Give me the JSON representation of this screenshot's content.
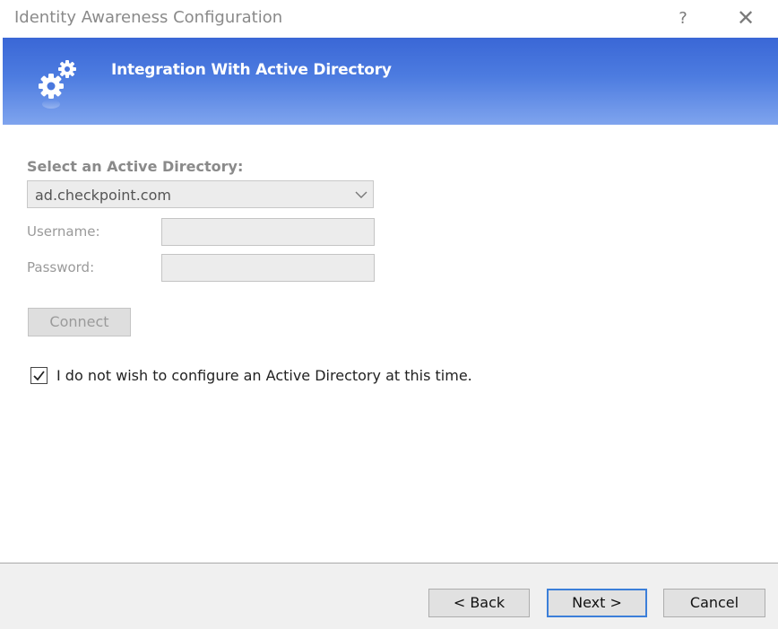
{
  "window": {
    "title": "Identity Awareness Configuration",
    "help_label": "?",
    "close_label": "✕"
  },
  "banner": {
    "title": "Integration With Active Directory",
    "icon": "gears-icon",
    "gradient_top": "#3a67d6",
    "gradient_bottom": "#7fa4ee"
  },
  "form": {
    "section_label": "Select an Active Directory:",
    "directory_select": {
      "value": "ad.checkpoint.com"
    },
    "username": {
      "label": "Username:",
      "value": ""
    },
    "password": {
      "label": "Password:",
      "value": ""
    },
    "connect_label": "Connect",
    "skip_checkbox": {
      "label": "I do not wish to configure an Active Directory at this time.",
      "checked": true
    }
  },
  "footer": {
    "back_label": "< Back",
    "next_label": "Next >",
    "cancel_label": "Cancel",
    "default_button_color": "#3c7fd9"
  }
}
